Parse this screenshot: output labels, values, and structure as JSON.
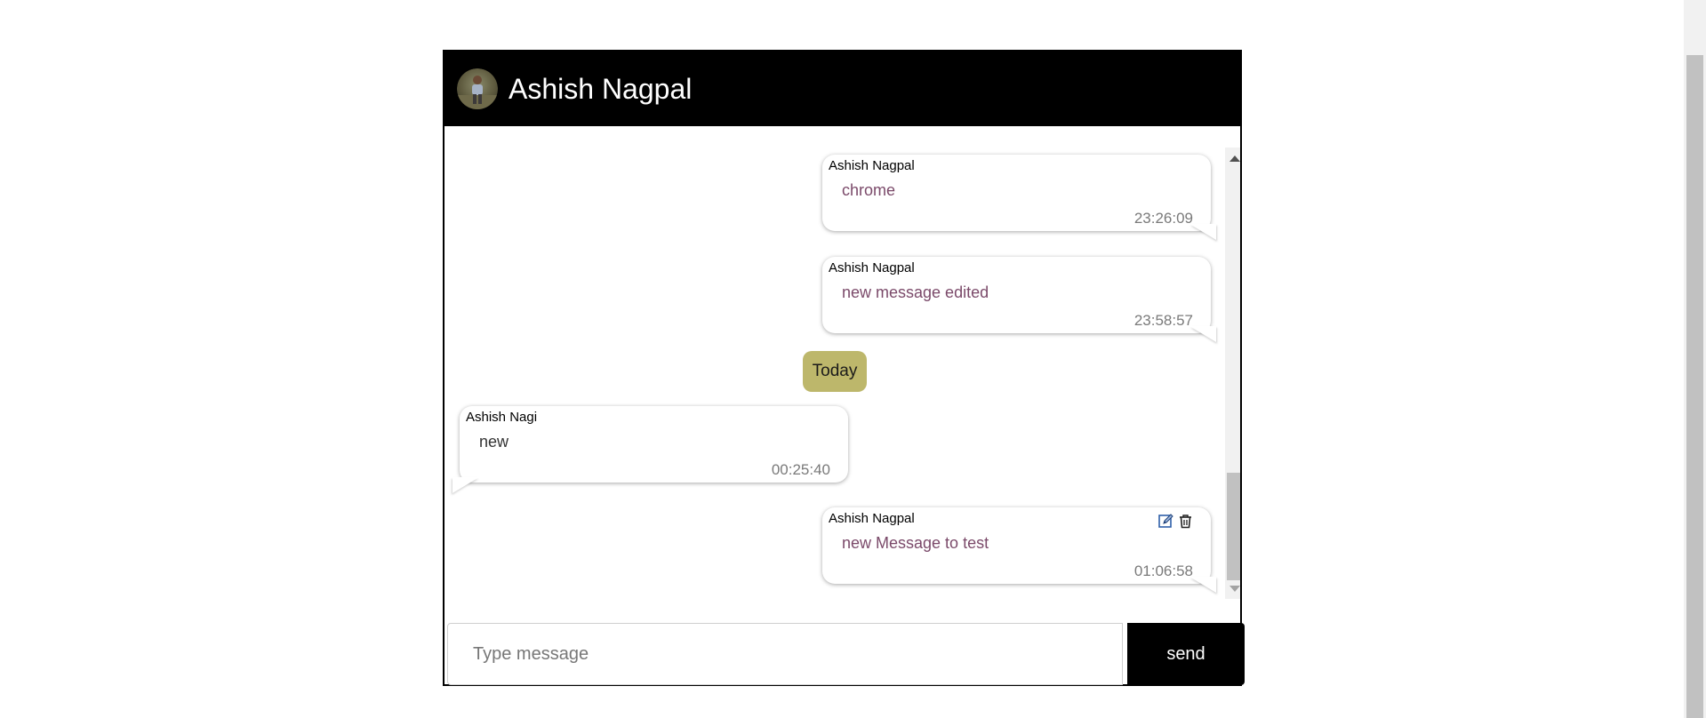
{
  "header": {
    "contact_name": "Ashish Nagpal",
    "avatar_alt": "profile photo"
  },
  "date_separator": "Today",
  "messages": [
    {
      "sender": "Ashish Nagpal",
      "text": "chrome",
      "time": "23:26:09",
      "side": "right"
    },
    {
      "sender": "Ashish Nagpal",
      "text": "new message edited",
      "time": "23:58:57",
      "side": "right"
    },
    {
      "sender": "Ashish Nagi",
      "text": "new",
      "time": "00:25:40",
      "side": "left"
    },
    {
      "sender": "Ashish Nagpal",
      "text": "new Message to test",
      "time": "01:06:58",
      "side": "right",
      "actions": [
        "edit-icon",
        "trash-icon"
      ]
    }
  ],
  "composer": {
    "placeholder": "Type message",
    "value": "",
    "send_label": "send"
  },
  "colors": {
    "header_bg": "#000000",
    "header_text": "#ffffff",
    "date_chip_bg": "#bdb76b",
    "outgoing_text": "#7b4a6a",
    "send_button_bg": "#000000"
  }
}
